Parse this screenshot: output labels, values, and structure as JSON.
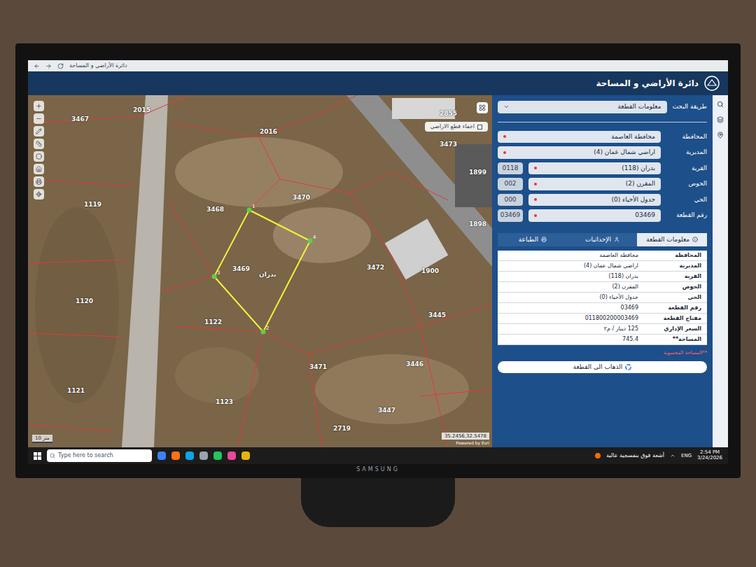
{
  "browser": {
    "title": "دائرة الأراضي و المساحة"
  },
  "header": {
    "title": "دائرة الأراضي و المساحة"
  },
  "map": {
    "labels": [
      "2015",
      "3467",
      "2016",
      "2855",
      "3473",
      "1899",
      "3468",
      "3470",
      "1119",
      "1898",
      "3469",
      "بدران",
      "3472",
      "1900",
      "1120",
      "1122",
      "3445",
      "3471",
      "3446",
      "1121",
      "1123",
      "3447",
      "2719"
    ],
    "vertices": [
      "1",
      "2",
      "3",
      "4"
    ],
    "hide_toggle": {
      "label": "اخفاء قطع الاراضي",
      "checked": false
    },
    "scale": "10 متر",
    "coordinates": "35.2456,32.5478",
    "attribution": "Powered by Esri"
  },
  "search": {
    "label": "طريقة البحث",
    "value": "معلومات القطعة"
  },
  "fields": [
    {
      "label": "المحافظة",
      "value": "محافظة العاصمة",
      "code": null
    },
    {
      "label": "المديرية",
      "value": "اراضي شمال عمان (4)",
      "code": null
    },
    {
      "label": "القرية",
      "value": "بدران (118)",
      "code": "0118"
    },
    {
      "label": "الحوض",
      "value": "المقرن (2)",
      "code": "002"
    },
    {
      "label": "الحي",
      "value": "جدول الأحياء (0)",
      "code": "000"
    },
    {
      "label": "رقم القطعة",
      "value": "03469",
      "code": "03469"
    }
  ],
  "tabs": [
    {
      "label": "معلومات القطعة",
      "selected": true
    },
    {
      "label": "الإحداثيات",
      "selected": false
    },
    {
      "label": "الطباعة",
      "selected": false
    }
  ],
  "info_rows": [
    {
      "label": "المحافظة",
      "value": "محافظة العاصمة"
    },
    {
      "label": "المديرية",
      "value": "اراضي شمال عمان (4)"
    },
    {
      "label": "القرية",
      "value": "بدران (118)"
    },
    {
      "label": "الحوض",
      "value": "المقرن (2)"
    },
    {
      "label": "الحي",
      "value": "جدول الأحياء (0)"
    },
    {
      "label": "رقم القطعة",
      "value": "03469"
    },
    {
      "label": "مفتاح القطعة",
      "value": "011800200003469"
    },
    {
      "label": "السعر الإداري",
      "value": "125 دينار / م٢"
    },
    {
      "label": "المساحة**",
      "value": "745.4"
    }
  ],
  "note": "**المساحة المحسوبة",
  "goto_button": "الذهاب الى القطعة",
  "taskbar": {
    "search_placeholder": "Type here to search",
    "weather": "أشعة فوق بنفسجية عالية",
    "language": "ENG",
    "time": "2:54 PM",
    "date": "3/24/2026"
  },
  "monitor": {
    "brand": "SAMSUNG"
  }
}
